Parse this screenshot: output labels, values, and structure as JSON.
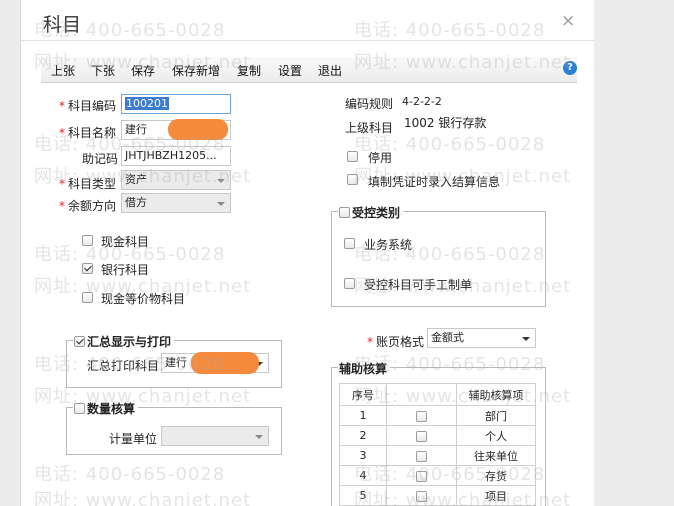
{
  "dialog": {
    "title": "科目",
    "close_symbol": "×"
  },
  "toolbar": {
    "buttons": [
      "上张",
      "下张",
      "保存",
      "保存新增",
      "复制",
      "设置",
      "退出"
    ],
    "help_symbol": "?"
  },
  "form": {
    "code_label": "科目编码",
    "code_value": "100201",
    "name_label": "科目名称",
    "name_value": "建行",
    "mnemonic_label": "助记码",
    "mnemonic_value": "JHTJHBZH1205...",
    "type_label": "科目类型",
    "type_value": "资产",
    "balance_label": "余额方向",
    "balance_value": "借方",
    "coding_rule_label": "编码规则",
    "coding_rule_value": "4-2-2-2",
    "parent_label": "上级科目",
    "parent_value": "1002 银行存款"
  },
  "options": {
    "disable_label": "停用",
    "settlement_label": "填制凭证时录入结算信息",
    "cash_label": "现金科目",
    "bank_label": "银行科目",
    "cash_equiv_label": "现金等价物科目"
  },
  "controlled": {
    "title": "受控类别",
    "business_label": "业务系统",
    "manual_label": "受控科目可手工制单"
  },
  "summary": {
    "title": "汇总显示与打印",
    "print_label": "汇总打印科目",
    "print_value": "建行"
  },
  "ledger": {
    "label": "账页格式",
    "value": "金额式"
  },
  "quantity": {
    "title": "数量核算",
    "unit_label": "计量单位"
  },
  "auxiliary": {
    "title": "辅助核算",
    "col_index": "序号",
    "col_item": "辅助核算项",
    "rows": [
      {
        "index": "1",
        "item": "部门"
      },
      {
        "index": "2",
        "item": "个人"
      },
      {
        "index": "3",
        "item": "往来单位"
      },
      {
        "index": "4",
        "item": "存货"
      },
      {
        "index": "5",
        "item": "项目"
      }
    ]
  },
  "watermark": {
    "phone": "电话: 400-665-0028",
    "site": "网址: www.chanjet.net"
  },
  "colors": {
    "required": "#e02020",
    "redaction": "#f58a3c",
    "help": "#2e7fd6",
    "selection": "#3b7bd1"
  }
}
